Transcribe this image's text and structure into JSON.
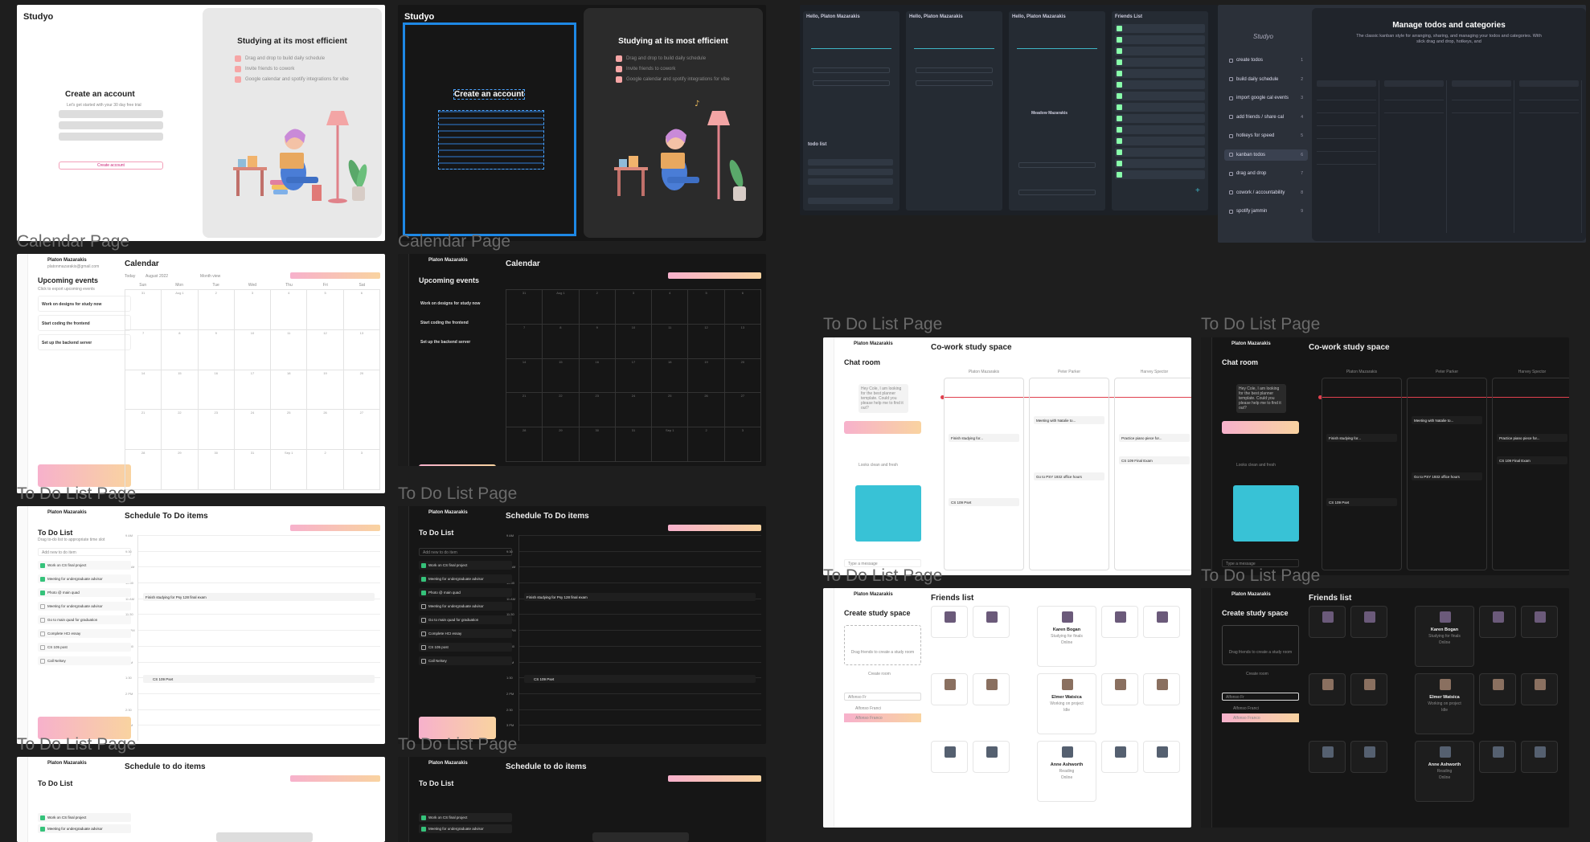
{
  "brand": "Studyo",
  "signup": {
    "heading": "Create an account",
    "sub": "Let's get started with your 30 day free trial",
    "create_btn": "Create account",
    "hero_title": "Studying at its most efficient",
    "bullets": [
      "Drag and drop to build daily schedule",
      "Invite friends to cowork",
      "Google calendar and spotify integrations for vibe"
    ]
  },
  "page_labels": {
    "calendar": "Calendar Page",
    "todo": "To Do List Page"
  },
  "user": {
    "name": "Platon Mazarakis",
    "email": "platonmazarakis@gmail.com"
  },
  "calendar": {
    "title": "Calendar",
    "upcoming_title": "Upcoming events",
    "upcoming_sub": "Click to export upcoming events",
    "events": [
      "Work on designs for study now",
      "Start coding the frontend",
      "Set up the backend server"
    ],
    "today_btn": "Today",
    "month": "August 2022",
    "view": "Month view",
    "days": [
      "Sun",
      "Mon",
      "Tue",
      "Wed",
      "Thu",
      "Fri",
      "Sat"
    ],
    "week_rows": [
      [
        "31",
        "Aug 1",
        "2",
        "3",
        "4",
        "5",
        "6"
      ],
      [
        "7",
        "8",
        "9",
        "10",
        "11",
        "12",
        "13"
      ],
      [
        "14",
        "15",
        "16",
        "17",
        "18",
        "19",
        "20"
      ],
      [
        "21",
        "22",
        "23",
        "24",
        "25",
        "26",
        "27"
      ],
      [
        "28",
        "29",
        "30",
        "31",
        "Sep 1",
        "2",
        "3"
      ]
    ]
  },
  "todo": {
    "title": "To Do List",
    "sub": "Drag to-do list to appropriate time slot",
    "add_placeholder": "Add new to do item",
    "schedule_title": "Schedule To Do items",
    "schedule_title_alt": "Schedule to do items",
    "items": [
      "Work on CS final project",
      "Meeting for undergraduate advisor",
      "Photo @ main quad",
      "Meeting for undergraduate advisor",
      "Go to main quad for graduation",
      "Complete HCI essay",
      "CS 105 post",
      "Call Nelsey"
    ],
    "checked": [
      true,
      true,
      true,
      false,
      false,
      false,
      false,
      false
    ],
    "times": [
      "9 AM",
      "9:30",
      "10 AM",
      "10:30",
      "11 AM",
      "11:30",
      "12 PM",
      "12:30",
      "1 PM",
      "1:30",
      "2 PM",
      "2:30",
      "3 PM"
    ],
    "scheduled": [
      "Finish studying for Psy 128 final exam",
      "CS 109 Pset"
    ]
  },
  "mobile": {
    "greeting": "Hello, Platon Mazarakis",
    "friends_title": "Friends List",
    "todo_list_title": "todo list",
    "meadow": "Meadow Mazarakis"
  },
  "features": {
    "logo": "Studyo",
    "items": [
      "create todos",
      "build daily schedule",
      "import google cal events",
      "add friends / share cal",
      "hotkeys for speed",
      "kanban todos",
      "drag and drop",
      "cowork / accountability",
      "spotify jammin"
    ],
    "counts": [
      "1",
      "2",
      "3",
      "4",
      "5",
      "6",
      "7",
      "8",
      "9"
    ],
    "active_index": 5,
    "panel_title": "Manage todos and categories",
    "panel_sub": "The classic kanban style for arranging, sharing, and managing your todos and categories. With slick drag and drop, hotkeys, and"
  },
  "cowork": {
    "chat_title": "Chat room",
    "space_title": "Co-work study space",
    "message_placeholder": "Type a message",
    "columns": [
      "Platon Mazarakis",
      "Peter Parker",
      "Harvey Spector"
    ],
    "msg1": "Hey Cole, I am looking for the best planner template. Could you please help me to find it out?",
    "msg2": "Looks clean and fresh",
    "tasks": [
      "Finish studying for...",
      "CS 109 Pset",
      "Meeting with Natalie to...",
      "Go to PSY 1932 office hours",
      "Practice piano piece for...",
      "CS 109 Final Exam"
    ]
  },
  "friends": {
    "create_title": "Create study space",
    "drag_hint": "Drag friends to create a study room",
    "create_btn": "Create room",
    "search": "Alfonso Fr",
    "results": [
      "Alfonso Franci",
      "Alfonso Franco"
    ],
    "list_title": "Friends list",
    "people": [
      {
        "name": "Karen Bogan",
        "sub": "Studying for finals",
        "status": "Online"
      },
      {
        "name": "Elmer Watsica",
        "sub": "Working on project",
        "status": "Idle"
      },
      {
        "name": "Anne Ashworth",
        "sub": "Reading",
        "status": "Online"
      }
    ]
  },
  "colors": {
    "accent": "#f5a3c1",
    "accent2": "#f9d39f",
    "red": "#e0404e",
    "green": "#35c27a",
    "blue_select": "#1e88e5"
  }
}
